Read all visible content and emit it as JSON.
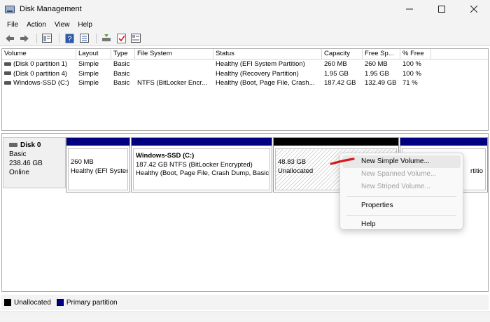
{
  "window": {
    "title": "Disk Management",
    "controls": [
      "minimize-icon",
      "maximize-icon",
      "close-icon"
    ]
  },
  "menu": [
    "File",
    "Action",
    "View",
    "Help"
  ],
  "toolbar": {
    "icons": [
      "back-arrow-icon",
      "forward-arrow-icon",
      "console-tree-icon",
      "help-icon",
      "properties-icon",
      "rescan-icon",
      "check-icon",
      "view-icon"
    ]
  },
  "volume_list": {
    "columns": [
      "Volume",
      "Layout",
      "Type",
      "File System",
      "Status",
      "Capacity",
      "Free Sp...",
      "% Free"
    ],
    "rows": [
      [
        "(Disk 0 partition 1)",
        "Simple",
        "Basic",
        "",
        "Healthy (EFI System Partition)",
        "260 MB",
        "260 MB",
        "100 %"
      ],
      [
        "(Disk 0 partition 4)",
        "Simple",
        "Basic",
        "",
        "Healthy (Recovery Partition)",
        "1.95 GB",
        "1.95 GB",
        "100 %"
      ],
      [
        "Windows-SSD (C:)",
        "Simple",
        "Basic",
        "NTFS (BitLocker Encr...",
        "Healthy (Boot, Page File, Crash...",
        "187.42 GB",
        "132.49 GB",
        "71 %"
      ]
    ]
  },
  "disk": {
    "name": "Disk 0",
    "type": "Basic",
    "size": "238.46 GB",
    "status": "Online",
    "partitions": [
      {
        "line1": "260 MB",
        "line2": "Healthy (EFI Syster"
      },
      {
        "title": "Windows-SSD  (C:)",
        "line1": "187.42 GB NTFS (BitLocker Encrypted)",
        "line2": "Healthy (Boot, Page File, Crash Dump, Basic"
      },
      {
        "line1": "48.83 GB",
        "line2": "Unallocated"
      },
      {
        "line1": "rtitio"
      }
    ]
  },
  "legend": [
    {
      "label": "Unallocated",
      "color": "#000000"
    },
    {
      "label": "Primary partition",
      "color": "#000080"
    }
  ],
  "context_menu": {
    "items": [
      {
        "label": "New Simple Volume...",
        "enabled": true
      },
      {
        "label": "New Spanned Volume...",
        "enabled": false
      },
      {
        "label": "New Striped Volume...",
        "enabled": false
      },
      {
        "label": "Properties",
        "enabled": true
      },
      {
        "label": "Help",
        "enabled": true
      }
    ]
  },
  "colors": {
    "primary_partition": "#000080",
    "unallocated": "#000000",
    "annotation": "#d7191c"
  }
}
